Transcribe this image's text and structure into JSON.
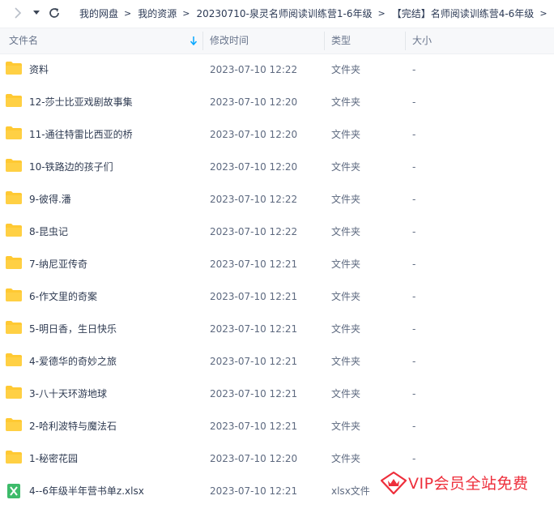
{
  "breadcrumb": [
    "我的网盘",
    "我的资源",
    "20230710-泉灵名师阅读训练营1-6年级",
    "【完结】名师阅读训练营4-6年级"
  ],
  "columns": {
    "name": "文件名",
    "modified": "修改时间",
    "type": "类型",
    "size": "大小"
  },
  "rows": [
    {
      "name": "资料",
      "modified": "2023-07-10 12:22",
      "type": "文件夹",
      "size": "-",
      "icon": "folder-icon"
    },
    {
      "name": "12-莎士比亚戏剧故事集",
      "modified": "2023-07-10 12:20",
      "type": "文件夹",
      "size": "-",
      "icon": "folder-icon"
    },
    {
      "name": "11-通往特雷比西亚的桥",
      "modified": "2023-07-10 12:20",
      "type": "文件夹",
      "size": "-",
      "icon": "folder-icon"
    },
    {
      "name": "10-铁路边的孩子们",
      "modified": "2023-07-10 12:20",
      "type": "文件夹",
      "size": "-",
      "icon": "folder-icon"
    },
    {
      "name": "9-彼得.潘",
      "modified": "2023-07-10 12:22",
      "type": "文件夹",
      "size": "-",
      "icon": "folder-icon"
    },
    {
      "name": "8-昆虫记",
      "modified": "2023-07-10 12:22",
      "type": "文件夹",
      "size": "-",
      "icon": "folder-icon"
    },
    {
      "name": "7-纳尼亚传奇",
      "modified": "2023-07-10 12:21",
      "type": "文件夹",
      "size": "-",
      "icon": "folder-icon"
    },
    {
      "name": "6-作文里的奇案",
      "modified": "2023-07-10 12:21",
      "type": "文件夹",
      "size": "-",
      "icon": "folder-icon"
    },
    {
      "name": "5-明日香，生日快乐",
      "modified": "2023-07-10 12:21",
      "type": "文件夹",
      "size": "-",
      "icon": "folder-icon"
    },
    {
      "name": "4-爱德华的奇妙之旅",
      "modified": "2023-07-10 12:21",
      "type": "文件夹",
      "size": "-",
      "icon": "folder-icon"
    },
    {
      "name": "3-八十天环游地球",
      "modified": "2023-07-10 12:21",
      "type": "文件夹",
      "size": "-",
      "icon": "folder-icon"
    },
    {
      "name": "2-哈利波特与魔法石",
      "modified": "2023-07-10 12:21",
      "type": "文件夹",
      "size": "-",
      "icon": "folder-icon"
    },
    {
      "name": "1-秘密花园",
      "modified": "2023-07-10 12:20",
      "type": "文件夹",
      "size": "-",
      "icon": "folder-icon"
    },
    {
      "name": "4--6年级半年营书单z.xlsx",
      "modified": "2023-07-10 12:21",
      "type": "xlsx文件",
      "size": "",
      "icon": "excel-icon"
    }
  ],
  "watermark": {
    "text": "VIP会员全站免费",
    "icon": "crown-icon"
  },
  "colors": {
    "folder": "#ffc933",
    "excel": "#3dbb6a",
    "accent": "#06a7ff",
    "watermark": "#ee2e3b"
  }
}
